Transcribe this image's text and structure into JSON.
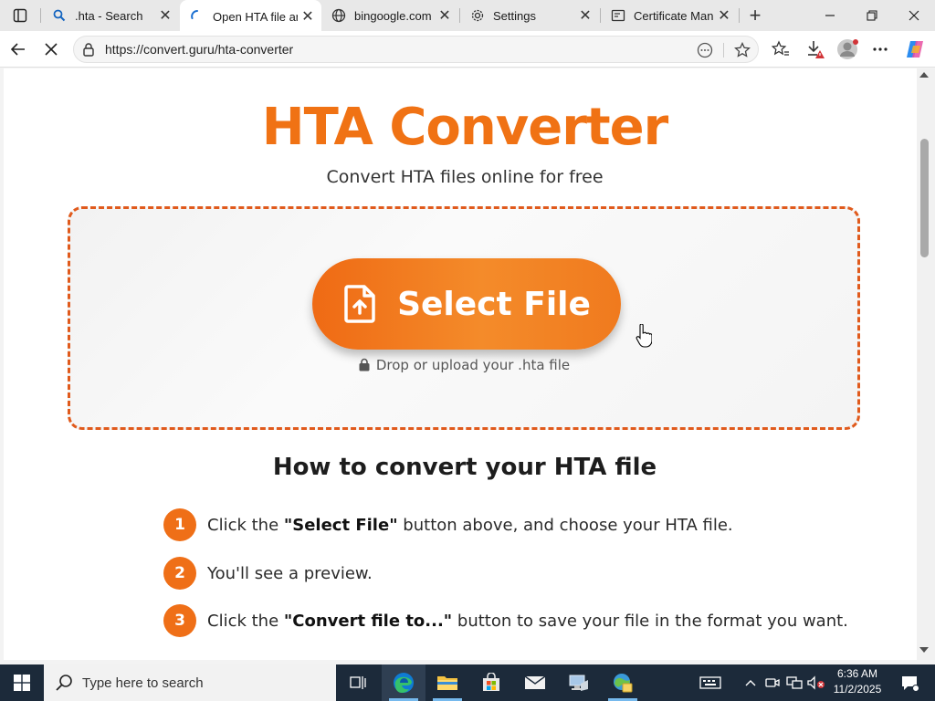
{
  "browser": {
    "tabs": [
      {
        "title": ".hta - Search",
        "icon": "search-icon"
      },
      {
        "title": "Open HTA file an",
        "icon": "loading-icon",
        "active": true
      },
      {
        "title": "bingoogle.com",
        "icon": "globe-icon"
      },
      {
        "title": "Settings",
        "icon": "gear-icon"
      },
      {
        "title": "Certificate Manag",
        "icon": "certificate-icon"
      }
    ],
    "new_tab": "+",
    "close_glyph": "✕",
    "url": "https://convert.guru/hta-converter"
  },
  "page": {
    "title": "HTA Converter",
    "subtitle": "Convert HTA files online for free",
    "select_button": "Select File",
    "drop_hint": "Drop or upload your .hta file",
    "howto_title": "How to convert your HTA file",
    "steps": [
      {
        "num": "1",
        "pre": "Click the ",
        "bold": "\"Select File\"",
        "post": " button above, and choose your HTA file."
      },
      {
        "num": "2",
        "pre": "You'll see a preview.",
        "bold": "",
        "post": ""
      },
      {
        "num": "3",
        "pre": "Click the ",
        "bold": "\"Convert file to...\"",
        "post": " button to save your file in the format you want."
      }
    ]
  },
  "taskbar": {
    "search_placeholder": "Type here to search",
    "time": "6:36 AM",
    "date": "11/2/2025"
  },
  "colors": {
    "accent": "#f07214",
    "dashed_border": "#e05a1c",
    "taskbar": "#1c2a3a"
  }
}
